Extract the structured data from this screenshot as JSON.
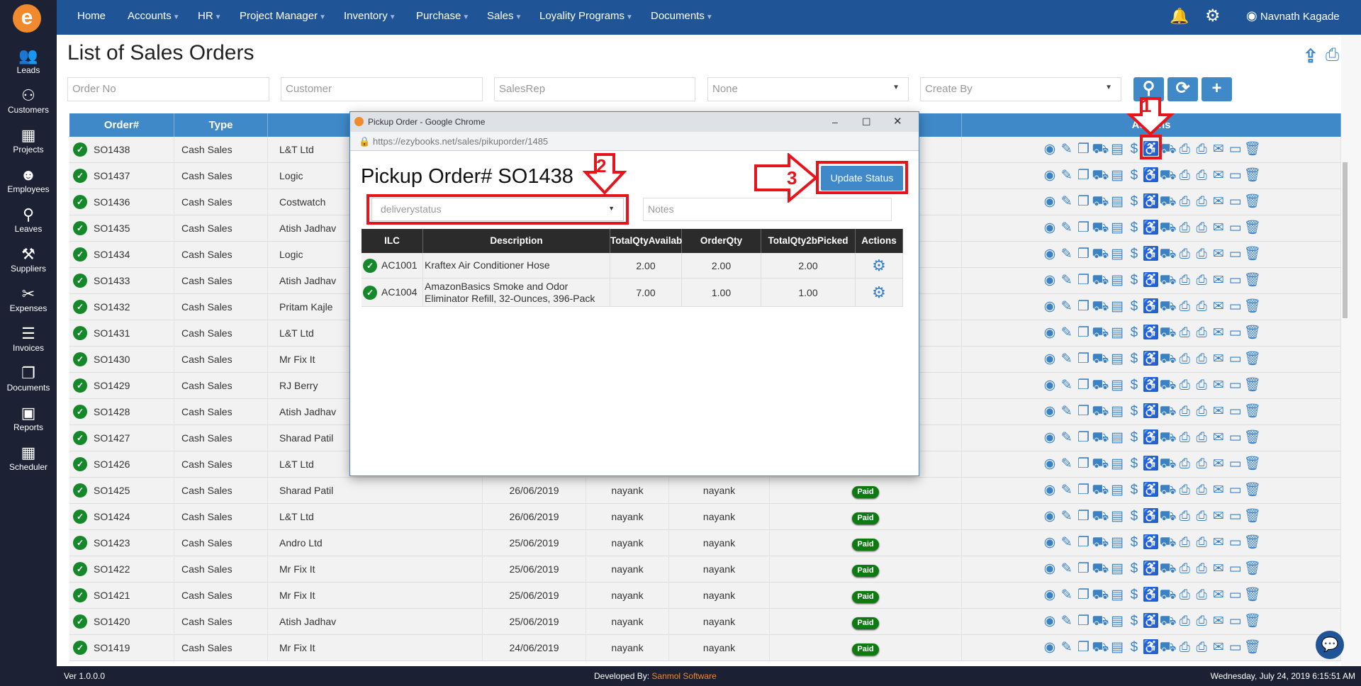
{
  "app": {
    "logo_letter": "e",
    "version": "Ver 1.0.0.0",
    "developed_by_label": "Developed By:",
    "developer": "Sanmol Software",
    "datetime": "Wednesday, July 24, 2019 6:15:51 AM",
    "accent": "#3f89c9",
    "nav_color": "#1f5596"
  },
  "sidebar": {
    "items": [
      {
        "label": "Leads",
        "icon": "leads-icon",
        "glyph": "👥"
      },
      {
        "label": "Customers",
        "icon": "customers-icon",
        "glyph": "⚇"
      },
      {
        "label": "Projects",
        "icon": "projects-icon",
        "glyph": "▦"
      },
      {
        "label": "Employees",
        "icon": "employees-icon",
        "glyph": "☻"
      },
      {
        "label": "Leaves",
        "icon": "leaves-icon",
        "glyph": "⚲"
      },
      {
        "label": "Suppliers",
        "icon": "suppliers-icon",
        "glyph": "⚒"
      },
      {
        "label": "Expenses",
        "icon": "expenses-icon",
        "glyph": "✂"
      },
      {
        "label": "Invoices",
        "icon": "invoices-icon",
        "glyph": "☰"
      },
      {
        "label": "Documents",
        "icon": "documents-icon",
        "glyph": "❐"
      },
      {
        "label": "Reports",
        "icon": "reports-icon",
        "glyph": "▣"
      },
      {
        "label": "Scheduler",
        "icon": "calendar-icon",
        "glyph": "▦"
      }
    ]
  },
  "navbar": {
    "items": [
      {
        "label": "Home",
        "dropdown": false
      },
      {
        "label": "Accounts",
        "dropdown": true
      },
      {
        "label": "HR",
        "dropdown": true
      },
      {
        "label": "Project Manager",
        "dropdown": true
      },
      {
        "label": "Inventory",
        "dropdown": true
      },
      {
        "label": "Purchase",
        "dropdown": true
      },
      {
        "label": "Sales",
        "dropdown": true
      },
      {
        "label": "Loyality Programs",
        "dropdown": true
      },
      {
        "label": "Documents",
        "dropdown": true
      }
    ],
    "user": "Navnath Kagade"
  },
  "page": {
    "title": "List of Sales Orders"
  },
  "filters": {
    "order_no_placeholder": "Order No",
    "customer_placeholder": "Customer",
    "salesrep_placeholder": "SalesRep",
    "status_value": "None",
    "create_by_value": "Create By"
  },
  "table": {
    "headers": [
      "Order#",
      "Type",
      "",
      "",
      "",
      "",
      "",
      "Actions"
    ],
    "action_icons": [
      "view-icon",
      "edit-icon",
      "copy-icon",
      "cart-icon",
      "invoice-icon",
      "dollar-icon",
      "pickup-icon",
      "delivery-icon",
      "print-icon",
      "print-icon",
      "email-icon",
      "folder-icon",
      "delete-icon"
    ],
    "rows": [
      {
        "order": "SO1438",
        "type": "Cash Sales",
        "customer": "L&T Ltd"
      },
      {
        "order": "SO1437",
        "type": "Cash Sales",
        "customer": "Logic"
      },
      {
        "order": "SO1436",
        "type": "Cash Sales",
        "customer": "Costwatch"
      },
      {
        "order": "SO1435",
        "type": "Cash Sales",
        "customer": "Atish Jadhav"
      },
      {
        "order": "SO1434",
        "type": "Cash Sales",
        "customer": "Logic"
      },
      {
        "order": "SO1433",
        "type": "Cash Sales",
        "customer": "Atish Jadhav"
      },
      {
        "order": "SO1432",
        "type": "Cash Sales",
        "customer": "Pritam Kajle"
      },
      {
        "order": "SO1431",
        "type": "Cash Sales",
        "customer": "L&T Ltd"
      },
      {
        "order": "SO1430",
        "type": "Cash Sales",
        "customer": "Mr Fix It"
      },
      {
        "order": "SO1429",
        "type": "Cash Sales",
        "customer": "RJ Berry"
      },
      {
        "order": "SO1428",
        "type": "Cash Sales",
        "customer": "Atish Jadhav"
      },
      {
        "order": "SO1427",
        "type": "Cash Sales",
        "customer": "Sharad Patil"
      },
      {
        "order": "SO1426",
        "type": "Cash Sales",
        "customer": "L&T Ltd"
      },
      {
        "order": "SO1425",
        "type": "Cash Sales",
        "customer": "Sharad Patil",
        "date": "26/06/2019",
        "rep": "nayank",
        "created_by": "nayank",
        "status": "Paid"
      },
      {
        "order": "SO1424",
        "type": "Cash Sales",
        "customer": "L&T Ltd",
        "date": "26/06/2019",
        "rep": "nayank",
        "created_by": "nayank",
        "status": "Paid"
      },
      {
        "order": "SO1423",
        "type": "Cash Sales",
        "customer": "Andro Ltd",
        "date": "25/06/2019",
        "rep": "nayank",
        "created_by": "nayank",
        "status": "Paid"
      },
      {
        "order": "SO1422",
        "type": "Cash Sales",
        "customer": "Mr Fix It",
        "date": "25/06/2019",
        "rep": "nayank",
        "created_by": "nayank",
        "status": "Paid"
      },
      {
        "order": "SO1421",
        "type": "Cash Sales",
        "customer": "Mr Fix It",
        "date": "25/06/2019",
        "rep": "nayank",
        "created_by": "nayank",
        "status": "Paid"
      },
      {
        "order": "SO1420",
        "type": "Cash Sales",
        "customer": "Atish Jadhav",
        "date": "25/06/2019",
        "rep": "nayank",
        "created_by": "nayank",
        "status": "Paid"
      },
      {
        "order": "SO1419",
        "type": "Cash Sales",
        "customer": "Mr Fix It",
        "date": "24/06/2019",
        "rep": "nayank",
        "created_by": "nayank",
        "status": "Paid"
      }
    ]
  },
  "popup": {
    "window_title": "Pickup Order - Google Chrome",
    "url": "https://ezybooks.net/sales/pikuporder/1485",
    "heading": "Pickup Order# SO1438",
    "status_placeholder": "deliverystatus",
    "notes_placeholder": "Notes",
    "update_button": "Update Status",
    "headers": [
      "ILC",
      "Description",
      "TotalQtyAvailable",
      "OrderQty",
      "TotalQty2bPicked",
      "Actions"
    ],
    "rows": [
      {
        "ilc": "AC1001",
        "description": "Kraftex Air Conditioner Hose",
        "available": "2.00",
        "order_qty": "2.00",
        "to_pick": "2.00"
      },
      {
        "ilc": "AC1004",
        "description": "AmazonBasics Smoke and Odor Eliminator Refill, 32-Ounces, 396-Pack",
        "available": "7.00",
        "order_qty": "1.00",
        "to_pick": "1.00"
      }
    ]
  },
  "annotations": [
    "1",
    "2",
    "3"
  ],
  "annotation_color": "#e8141c"
}
